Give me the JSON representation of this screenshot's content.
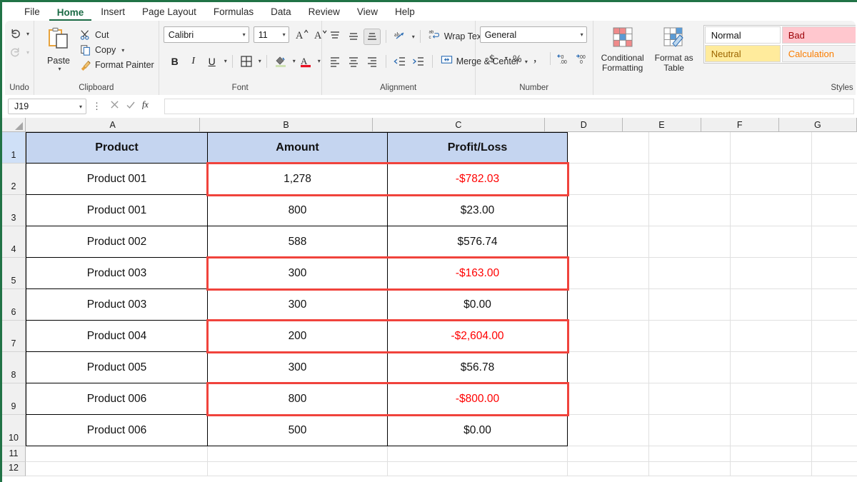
{
  "menu": {
    "items": [
      {
        "label": "File",
        "active": false
      },
      {
        "label": "Home",
        "active": true
      },
      {
        "label": "Insert",
        "active": false
      },
      {
        "label": "Page Layout",
        "active": false
      },
      {
        "label": "Formulas",
        "active": false
      },
      {
        "label": "Data",
        "active": false
      },
      {
        "label": "Review",
        "active": false
      },
      {
        "label": "View",
        "active": false
      },
      {
        "label": "Help",
        "active": false
      }
    ]
  },
  "ribbon": {
    "undo": {
      "group_label": "Undo",
      "undo_icon": "undo-arrow-icon",
      "redo_icon": "redo-arrow-icon"
    },
    "clipboard": {
      "group_label": "Clipboard",
      "paste_label": "Paste",
      "paste_icon": "clipboard-icon",
      "cut_label": "Cut",
      "cut_icon": "scissors-icon",
      "copy_label": "Copy",
      "copy_icon": "copy-pages-icon",
      "format_painter_label": "Format Painter",
      "format_painter_icon": "paintbrush-icon"
    },
    "font": {
      "group_label": "Font",
      "font_name": "Calibri",
      "font_size": "11",
      "grow_font_icon": "grow-font-icon",
      "shrink_font_icon": "shrink-font-icon",
      "bold_label": "B",
      "italic_label": "I",
      "underline_label": "U",
      "borders_icon": "borders-grid-icon",
      "fill_color_icon": "fill-bucket-icon",
      "font_color_icon": "font-color-A-icon"
    },
    "alignment": {
      "group_label": "Alignment",
      "top_align_icon": "align-top-icon",
      "middle_align_icon": "align-middle-icon",
      "bottom_align_icon": "align-bottom-icon",
      "orientation_icon": "text-orientation-icon",
      "align_left_icon": "align-left-icon",
      "align_center_icon": "align-center-icon",
      "align_right_icon": "align-right-icon",
      "decrease_indent_icon": "decrease-indent-icon",
      "increase_indent_icon": "increase-indent-icon",
      "wrap_text_label": "Wrap Text",
      "wrap_text_icon": "wrap-text-icon",
      "merge_center_label": "Merge & Center",
      "merge_center_icon": "merge-cells-icon"
    },
    "number": {
      "group_label": "Number",
      "format_value": "General",
      "accounting_icon": "dollar-sign-icon",
      "percent_icon": "percent-icon",
      "comma_icon": "comma-style-icon",
      "increase_decimal_icon": "increase-decimal-icon",
      "decrease_decimal_icon": "decrease-decimal-icon"
    },
    "styles": {
      "group_label": "Styles",
      "conditional_formatting_label": "Conditional Formatting",
      "conditional_formatting_icon": "conditional-formatting-icon",
      "format_as_table_label": "Format as Table",
      "format_as_table_icon": "format-as-table-icon",
      "cells": [
        {
          "label": "Normal",
          "style": "st-normal"
        },
        {
          "label": "Bad",
          "style": "st-bad"
        },
        {
          "label": "Neutral",
          "style": "st-neutral"
        },
        {
          "label": "Calculation",
          "style": "st-calc"
        }
      ]
    }
  },
  "formula_bar": {
    "name_box_value": "J19",
    "cancel_icon": "cancel-x-icon",
    "enter_icon": "enter-check-icon",
    "function_icon": "fx-icon",
    "formula_value": ""
  },
  "grid": {
    "column_headers": [
      "A",
      "B",
      "C",
      "D",
      "E",
      "F",
      "G"
    ],
    "row_headers": [
      "1",
      "2",
      "3",
      "4",
      "5",
      "6",
      "7",
      "8",
      "9",
      "10",
      "11",
      "12"
    ],
    "selected_row_header": "1",
    "table": {
      "headers": [
        "Product",
        "Amount",
        "Profit/Loss"
      ],
      "rows": [
        {
          "product": "Product 001",
          "amount": "1,278",
          "profit_loss": "-$782.03",
          "negative": true,
          "highlighted": true
        },
        {
          "product": "Product 001",
          "amount": "800",
          "profit_loss": "$23.00",
          "negative": false,
          "highlighted": false
        },
        {
          "product": "Product 002",
          "amount": "588",
          "profit_loss": "$576.74",
          "negative": false,
          "highlighted": false
        },
        {
          "product": "Product 003",
          "amount": "300",
          "profit_loss": "-$163.00",
          "negative": true,
          "highlighted": true
        },
        {
          "product": "Product 003",
          "amount": "300",
          "profit_loss": "$0.00",
          "negative": false,
          "highlighted": false
        },
        {
          "product": "Product 004",
          "amount": "200",
          "profit_loss": "-$2,604.00",
          "negative": true,
          "highlighted": true
        },
        {
          "product": "Product 005",
          "amount": "300",
          "profit_loss": "$56.78",
          "negative": false,
          "highlighted": false
        },
        {
          "product": "Product 006",
          "amount": "800",
          "profit_loss": "-$800.00",
          "negative": true,
          "highlighted": true
        },
        {
          "product": "Product 006",
          "amount": "500",
          "profit_loss": "$0.00",
          "negative": false,
          "highlighted": false
        }
      ]
    }
  },
  "colors": {
    "accent_green": "#217346",
    "header_fill": "#c5d5f0",
    "negative_text": "#ff0000",
    "highlight_border": "#f0433c",
    "selected_row_header": "#cfe0f7"
  }
}
